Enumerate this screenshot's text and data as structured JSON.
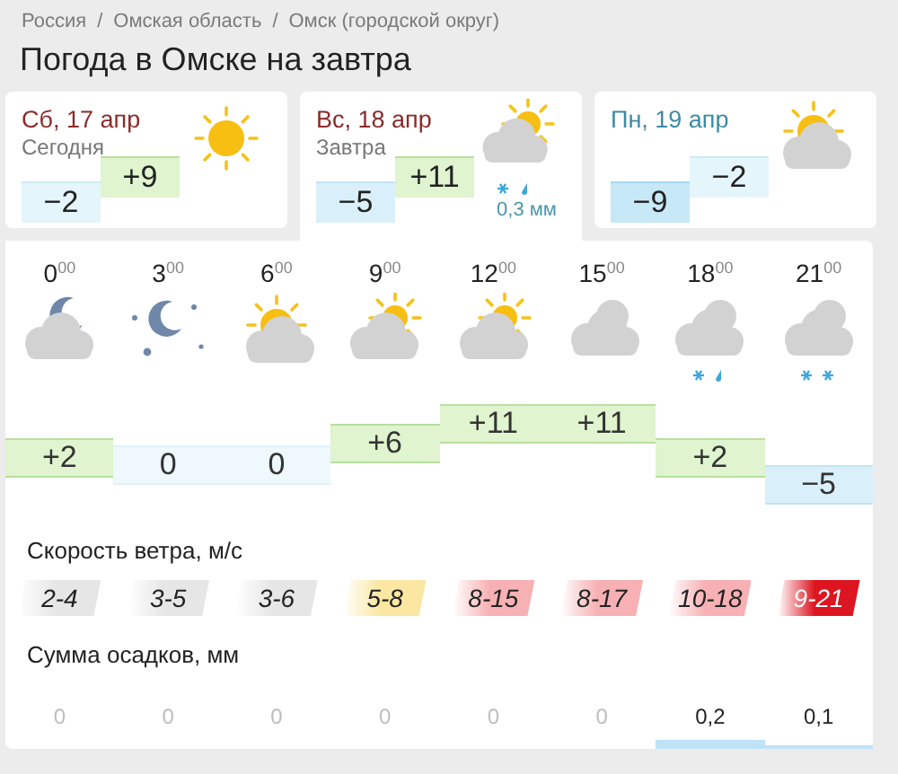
{
  "breadcrumbs": [
    "Россия",
    "Омская область",
    "Омск (городской округ)"
  ],
  "breadcrumb_separator": "/",
  "title": "Погода в Омске на завтра",
  "days": [
    {
      "date": "Сб, 17 апр",
      "weekend": true,
      "subtitle": "Сегодня",
      "kind": "sun",
      "min": "−2",
      "max": "+9",
      "selected": false
    },
    {
      "date": "Вс, 18 апр",
      "weekend": true,
      "subtitle": "Завтра",
      "kind": "cloud-sun-snow",
      "min": "−5",
      "max": "+11",
      "precipitation": "0,3 мм",
      "selected": true
    },
    {
      "date": "Пн, 19 апр",
      "weekend": false,
      "kind": "sun-cloud",
      "min": "−9",
      "max": "−2",
      "selected": false
    }
  ],
  "hours": [
    {
      "time": "0$^{00}$",
      "kind": "cloud-moon",
      "temp": "+2"
    },
    {
      "time": "3$^{00}$",
      "kind": "moon-stars",
      "temp": "0"
    },
    {
      "time": "6$^{00}$",
      "kind": "sun-cloud",
      "temp": "0"
    },
    {
      "time": "9$^{00}$",
      "kind": "cloud-sun",
      "temp": "+6"
    },
    {
      "time": "12$^{00}$",
      "kind": "cloud-sun",
      "temp": "+11"
    },
    {
      "time": "15$^{00}$",
      "kind": "cloud",
      "temp": "+11"
    },
    {
      "time": "18$^{00}$",
      "kind": "cloud-snow-rain",
      "temp": "+2"
    },
    {
      "time": "21$^{00}$",
      "kind": "cloud-snow",
      "temp": "−5"
    }
  ],
  "wind": {
    "label": "Скорость ветра, м/с",
    "values": [
      {
        "value": "2-4",
        "color": "#e6e6e6"
      },
      {
        "value": "3-5",
        "color": "#e6e6e6"
      },
      {
        "value": "3-6",
        "color": "#e6e6e6"
      },
      {
        "value": "5-8",
        "color": "#fbe7a1"
      },
      {
        "value": "8-15",
        "color": "#f7b0b3"
      },
      {
        "value": "8-17",
        "color": "#f7b0b3"
      },
      {
        "value": "10-18",
        "color": "#f7b0b3"
      },
      {
        "value": "9-21",
        "color": "#dd1520"
      }
    ]
  },
  "precipitation": {
    "label": "Сумма осадков, мм",
    "values": [
      {
        "value": "0",
        "kind": "zero"
      },
      {
        "value": "0",
        "kind": "zero"
      },
      {
        "value": "0",
        "kind": "zero"
      },
      {
        "value": "0",
        "kind": "zero"
      },
      {
        "value": "0",
        "kind": "zero"
      },
      {
        "value": "0",
        "kind": "zero"
      },
      {
        "value": "0,2",
        "kind": "amount"
      },
      {
        "value": "0,1",
        "kind": "amount"
      }
    ]
  }
}
